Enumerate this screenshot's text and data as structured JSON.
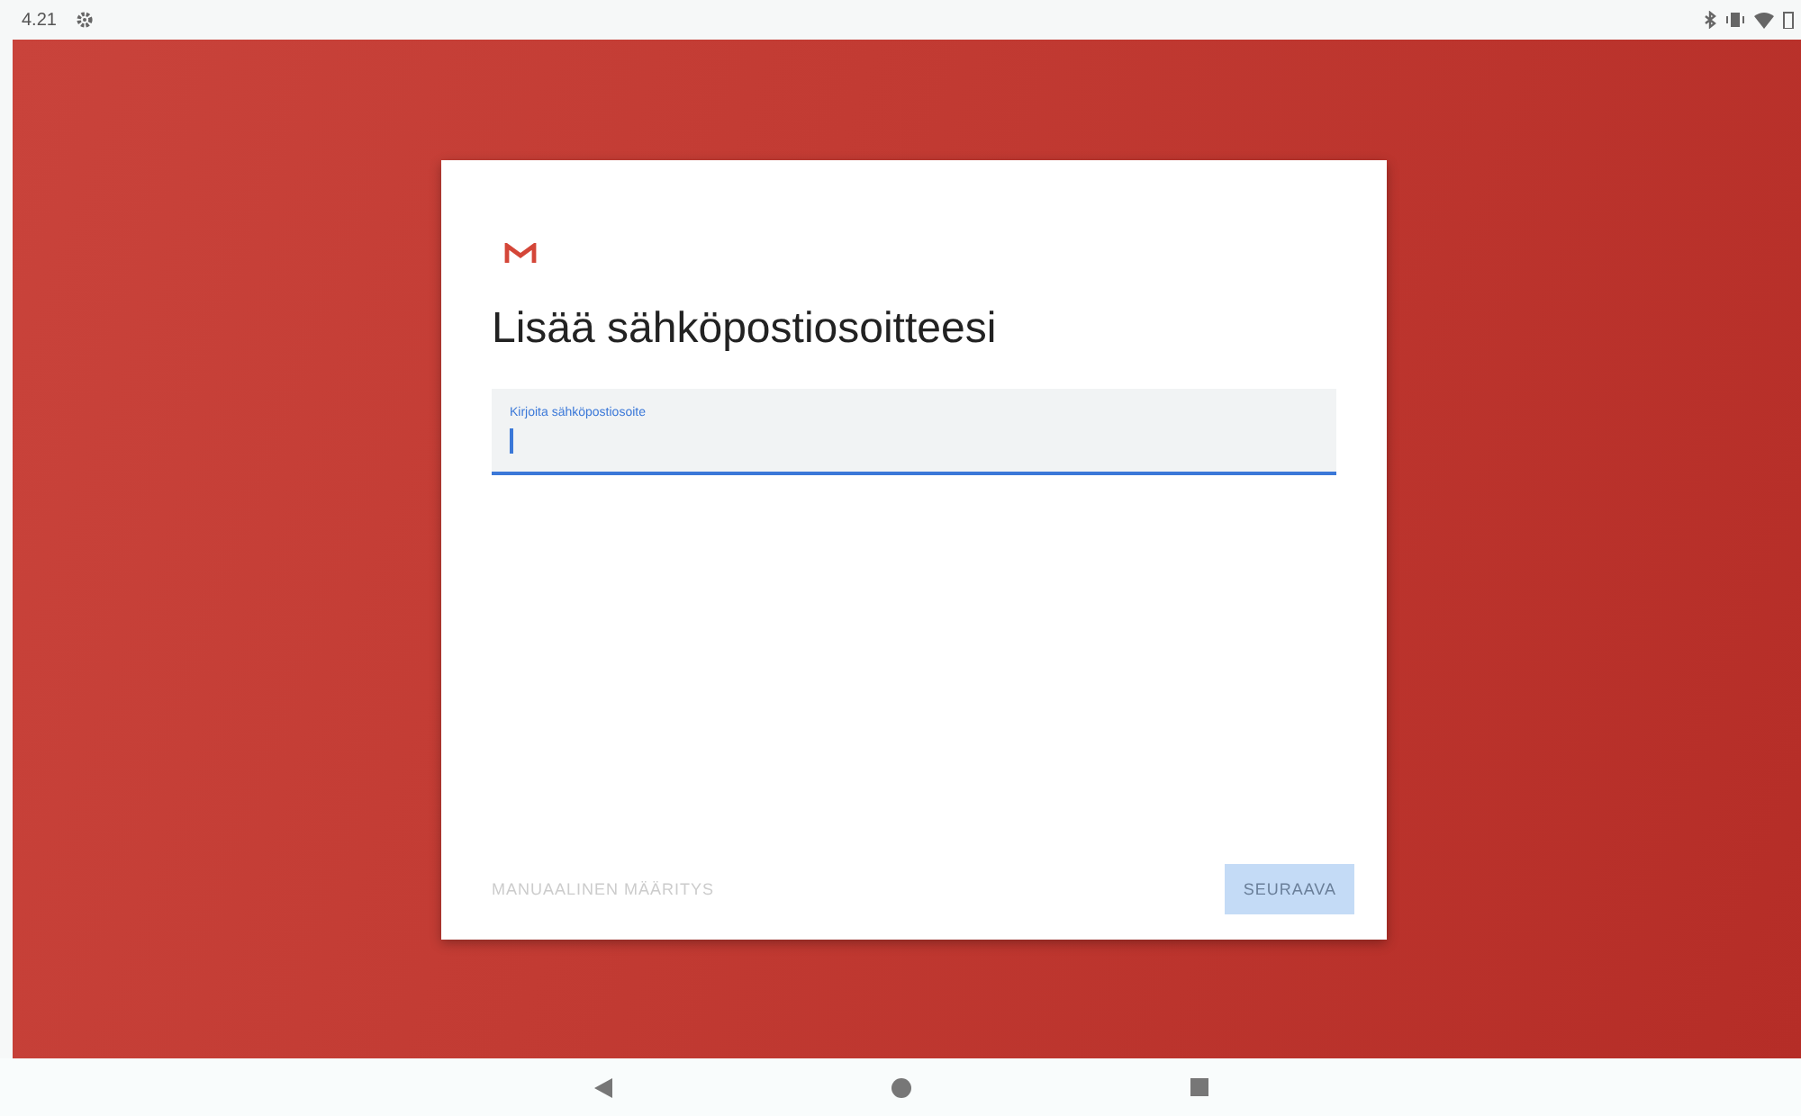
{
  "status_bar": {
    "time": "4.21"
  },
  "dialog": {
    "title": "Lisää sähköpostiosoitteesi",
    "email_field": {
      "label": "Kirjoita sähköpostiosoite",
      "focused": true
    },
    "buttons": [
      {
        "label": "MANUAALINEN MÄÄRITYS",
        "kind": "text",
        "disabled": true
      },
      {
        "label": "SEURAAVA",
        "kind": "filled",
        "disabled": true
      }
    ]
  }
}
